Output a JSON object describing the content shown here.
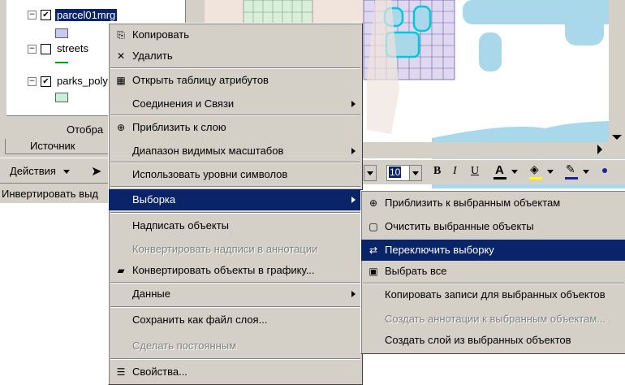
{
  "toc": {
    "layers": [
      {
        "name": "parcel01mrg",
        "checked": true,
        "selected": true,
        "symbol_color": "#c8c8f0"
      },
      {
        "name": "streets",
        "checked": false,
        "selected": false,
        "symbol_color": "#00a000"
      },
      {
        "name": "parks_poly",
        "checked": true,
        "selected": false,
        "symbol_color": "#c8f0d8"
      }
    ],
    "tab_display": "Отобра",
    "tab_source": "Источник",
    "actions_label": "Действия",
    "status_text": "Инвертировать выд"
  },
  "format_toolbar": {
    "font_size": "10",
    "bold": "B",
    "italic": "I",
    "underline": "U",
    "font_color_letter": "A"
  },
  "context_menu": {
    "items": [
      {
        "label": "Копировать",
        "icon": "copy-icon",
        "glyph": "⎘"
      },
      {
        "label": "Удалить",
        "icon": "delete-icon",
        "glyph": "✕"
      },
      {
        "label": "Открыть таблицу атрибутов",
        "icon": "table-icon",
        "glyph": "▦"
      },
      {
        "label": "Соединения и Связи",
        "submenu": true
      },
      {
        "label": "Приблизить к слою",
        "icon": "zoom-to-layer-icon",
        "glyph": "⊕"
      },
      {
        "label": "Диапазон видимых масштабов",
        "submenu": true
      },
      {
        "label": "Использовать уровни символов"
      },
      {
        "label": "Выборка",
        "submenu": true,
        "highlighted": true
      },
      {
        "label": "Надписать объекты"
      },
      {
        "label": "Конвертировать надписи в аннотации",
        "disabled": true
      },
      {
        "label": "Конвертировать объекты в графику...",
        "icon": "convert-graphics-icon",
        "glyph": "▰"
      },
      {
        "label": "Данные",
        "submenu": true
      },
      {
        "label": "Сохранить как файл слоя..."
      },
      {
        "label": "Сделать постоянным",
        "disabled": true
      },
      {
        "label": "Свойства...",
        "icon": "properties-icon",
        "glyph": "☰"
      }
    ]
  },
  "selection_submenu": {
    "items": [
      {
        "label": "Приблизить к выбранным объектам",
        "icon": "zoom-to-selected-icon",
        "glyph": "⊕"
      },
      {
        "label": "Очистить выбранные объекты",
        "icon": "clear-selection-icon",
        "glyph": "▢"
      },
      {
        "label": "Переключить выборку",
        "icon": "switch-selection-icon",
        "glyph": "⇄",
        "highlighted": true
      },
      {
        "label": "Выбрать все",
        "icon": "select-all-icon",
        "glyph": "▣"
      },
      {
        "label": "Копировать записи для выбранных объектов"
      },
      {
        "label": "Создать аннотации к выбранным объектам...",
        "disabled": true
      },
      {
        "label": "Создать слой из выбранных объектов"
      }
    ]
  },
  "colors": {
    "menu_bg": "#d4d0c8",
    "highlight": "#0a246a",
    "map_water": "#a8d8ea",
    "map_parcels": "#e0d8f0",
    "map_land": "#f0e4dc",
    "map_green": "#d8f0d8"
  }
}
